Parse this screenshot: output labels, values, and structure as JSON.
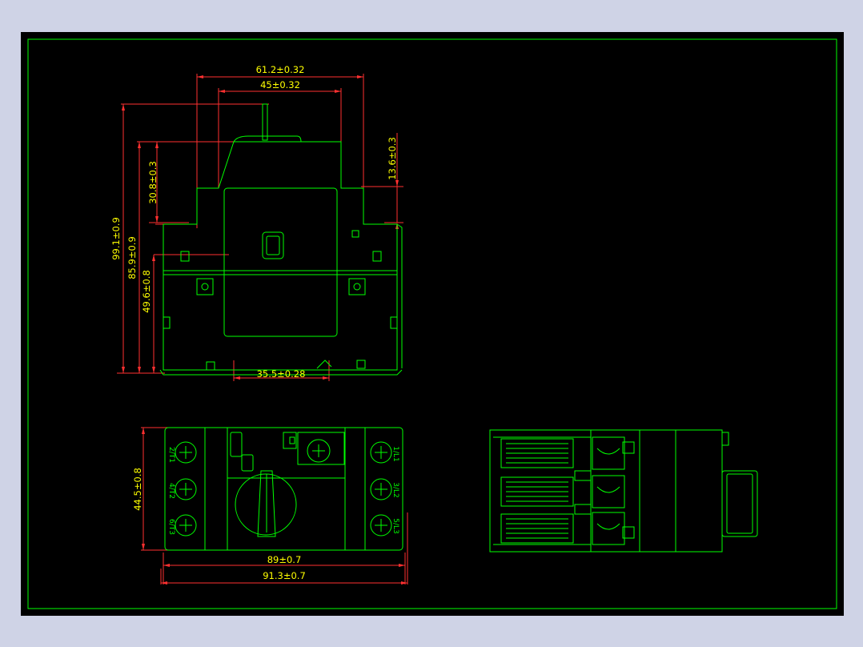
{
  "colors": {
    "background": "#cfd3e6",
    "sheet": "#000000",
    "outline": "#00ff00",
    "dimension_line": "#ff3030",
    "dimension_text": "#ffff00"
  },
  "front_view": {
    "dims": {
      "overall_width": "61.2±0.32",
      "inner_width": "45±0.32",
      "overall_height": "99.1±0.9",
      "body_height": "85.9±0.9",
      "lower_height": "49.6±0.8",
      "upper_height": "30.8±0.3",
      "step_height": "13.6±0.3",
      "base_width": "35.5±0.28"
    }
  },
  "top_view": {
    "dims": {
      "height": "44.5±0.8",
      "inner_length": "89±0.7",
      "overall_length": "91.3±0.7"
    },
    "terminals_left": [
      "2/T1",
      "4/T2",
      "6/T3"
    ],
    "terminals_right": [
      "1/L1",
      "3/L2",
      "5/L3"
    ]
  }
}
